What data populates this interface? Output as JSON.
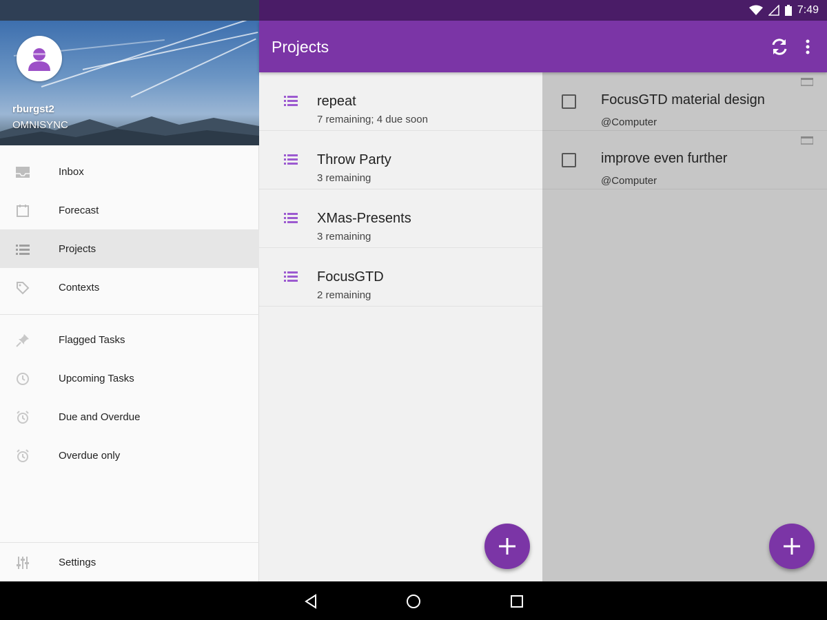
{
  "status_bar": {
    "time": "7:49",
    "icons": [
      "wifi-icon",
      "signal-icon",
      "battery-icon"
    ]
  },
  "drawer": {
    "user": {
      "name": "rburgst2",
      "account": "OMNISYNC"
    },
    "items": [
      {
        "label": "Inbox",
        "icon": "inbox-icon"
      },
      {
        "label": "Forecast",
        "icon": "calendar-icon"
      },
      {
        "label": "Projects",
        "icon": "list-icon",
        "selected": true
      },
      {
        "label": "Contexts",
        "icon": "tag-icon"
      },
      {
        "label": "Flagged Tasks",
        "icon": "pin-icon"
      },
      {
        "label": "Upcoming Tasks",
        "icon": "clock-icon"
      },
      {
        "label": "Due and Overdue",
        "icon": "alarm-icon"
      },
      {
        "label": "Overdue only",
        "icon": "alarm-icon"
      }
    ],
    "settings_label": "Settings"
  },
  "app_bar": {
    "title": "Projects",
    "actions": [
      "sync-icon",
      "more-vert-icon"
    ]
  },
  "projects": [
    {
      "name": "repeat",
      "meta": "7 remaining; 4 due soon"
    },
    {
      "name": "Throw Party",
      "meta": "3 remaining"
    },
    {
      "name": "XMas-Presents",
      "meta": "3 remaining"
    },
    {
      "name": "FocusGTD",
      "meta": "2 remaining"
    }
  ],
  "tasks": [
    {
      "name": "FocusGTD material design",
      "context": "@Computer",
      "checked": false
    },
    {
      "name": "improve even further",
      "context": "@Computer",
      "checked": false
    }
  ],
  "colors": {
    "primary": "#7b35a6",
    "status_bar": "#4a1c67",
    "accent_icon": "#9c5ad0"
  },
  "nav_buttons": [
    "back-icon",
    "home-icon",
    "recents-icon"
  ]
}
